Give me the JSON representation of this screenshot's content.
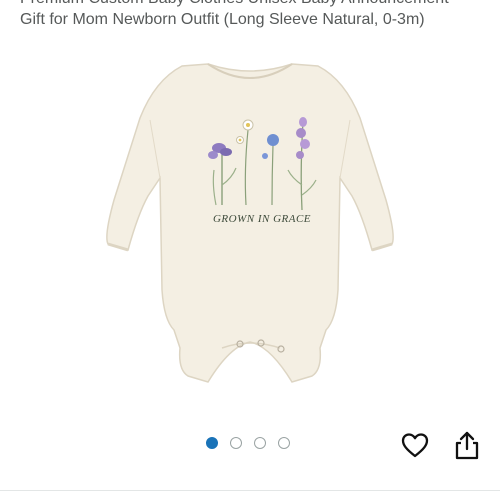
{
  "product": {
    "title_line1": "Premium Custom Baby Clothes Unisex Baby Announcement",
    "title_line2": "Gift for Mom Newborn Outfit (Long Sleeve Natural, 0-3m)"
  },
  "image": {
    "print_text": "GROWN IN GRACE",
    "garment_color": "#f4efe3"
  },
  "carousel": {
    "count": 4,
    "active_index": 0,
    "active_color": "#1a73b8"
  },
  "actions": {
    "favorite_icon": "heart-icon",
    "share_icon": "share-icon"
  }
}
